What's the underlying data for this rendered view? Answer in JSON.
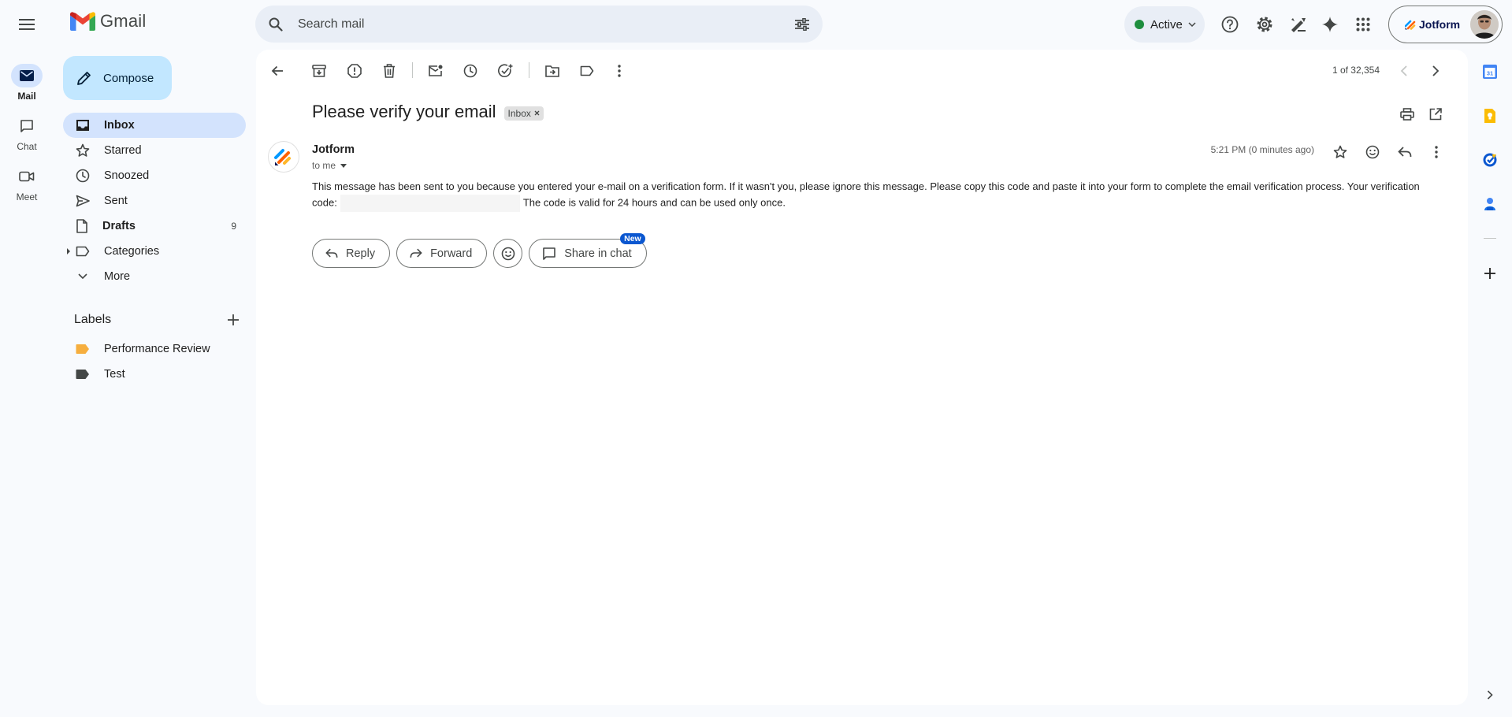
{
  "app": {
    "name": "Gmail"
  },
  "search": {
    "placeholder": "Search mail",
    "value": ""
  },
  "rail": {
    "items": [
      {
        "label": "Mail",
        "icon": "mail-icon",
        "active": true
      },
      {
        "label": "Chat",
        "icon": "chat-icon",
        "active": false
      },
      {
        "label": "Meet",
        "icon": "video-icon",
        "active": false
      }
    ]
  },
  "header": {
    "status": "Active",
    "status_color": "#1e8e3e",
    "account": {
      "brand": "Jotform"
    }
  },
  "compose": {
    "label": "Compose"
  },
  "nav": {
    "items": [
      {
        "label": "Inbox",
        "icon": "inbox-icon",
        "active": true,
        "bold": true
      },
      {
        "label": "Starred",
        "icon": "star-icon"
      },
      {
        "label": "Snoozed",
        "icon": "clock-icon"
      },
      {
        "label": "Sent",
        "icon": "send-icon"
      },
      {
        "label": "Drafts",
        "icon": "draft-icon",
        "bold": true,
        "count": "9"
      },
      {
        "label": "Categories",
        "icon": "label-outline-icon"
      },
      {
        "label": "More",
        "icon": "chevron-down-icon"
      }
    ]
  },
  "labels": {
    "title": "Labels",
    "items": [
      {
        "label": "Performance Review",
        "color": "#f6ae3e"
      },
      {
        "label": "Test",
        "color": "#444746"
      }
    ]
  },
  "toolbar": {
    "pager": "1 of 32,354"
  },
  "email": {
    "subject": "Please verify your email",
    "chip": "Inbox",
    "sender": "Jotform",
    "recipient": "to me",
    "timestamp": "5:21 PM (0 minutes ago)",
    "body_part1": "This message has been sent to you because you entered your e-mail on a verification form. If it wasn't you, please ignore this message. Please copy this code and paste it into your form to complete the email verification process. Your verification code:",
    "body_part2": "The code is valid for 24 hours and can be used only once."
  },
  "actions": {
    "reply": "Reply",
    "forward": "Forward",
    "share": "Share in chat",
    "badge": "New"
  },
  "colors": {
    "accent": "#0b57d0",
    "compose_bg": "#c2e7ff",
    "active_nav": "#d3e3fd"
  }
}
